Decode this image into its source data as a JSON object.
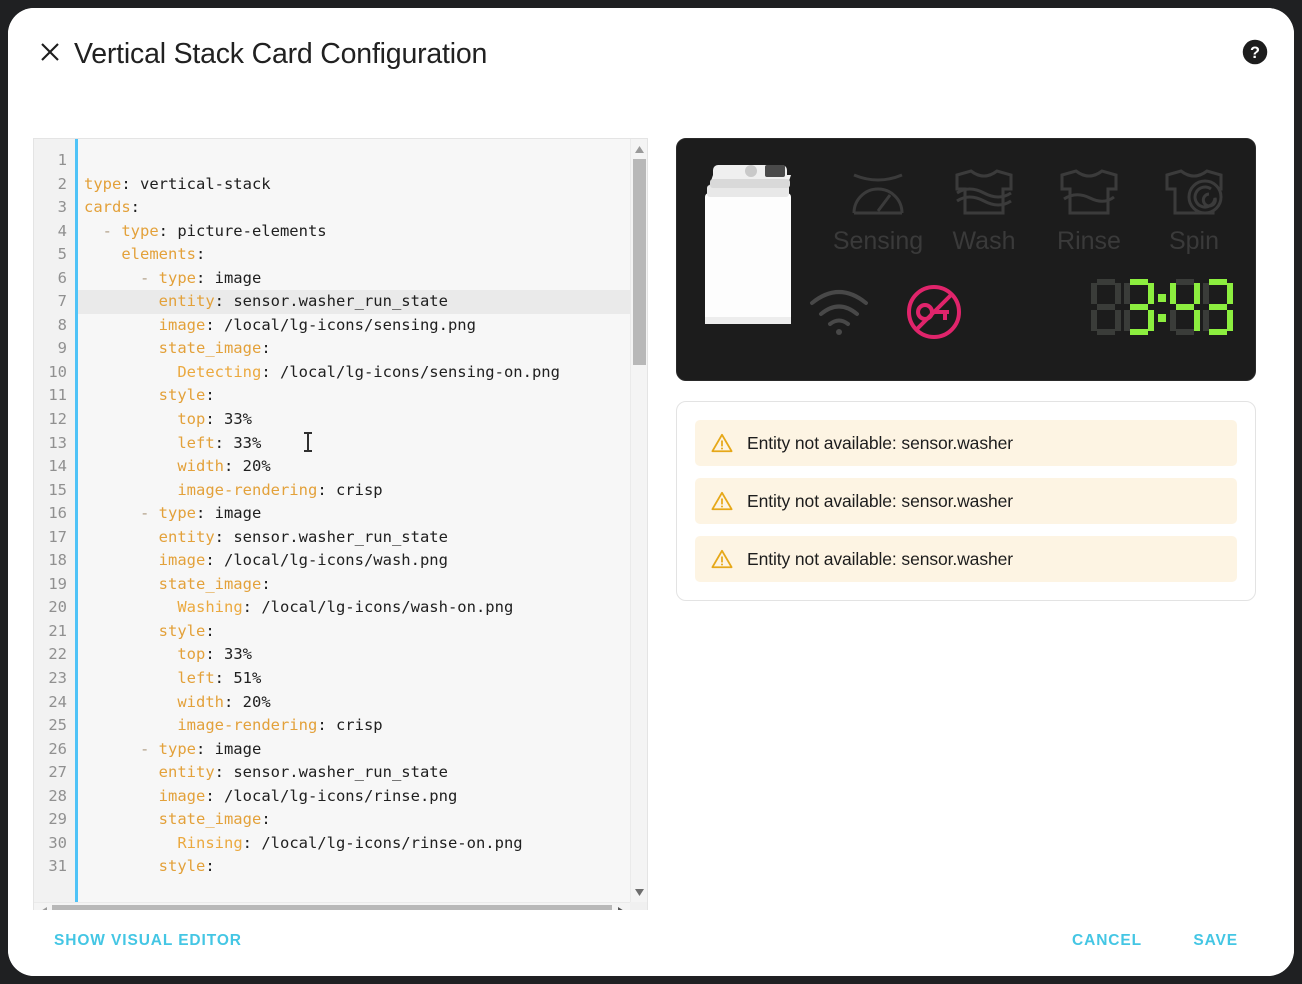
{
  "window": {
    "background_color": "#1f2022",
    "dialog_background": "#ffffff"
  },
  "header": {
    "title": "Vertical Stack Card Configuration",
    "close_icon": "close-icon",
    "help_icon": "help-circle-icon"
  },
  "editor": {
    "language": "yaml",
    "active_line": 7,
    "total_visible_lines": 31,
    "line_numbers": [
      1,
      2,
      3,
      4,
      5,
      6,
      7,
      8,
      9,
      10,
      11,
      12,
      13,
      14,
      15,
      16,
      17,
      18,
      19,
      20,
      21,
      22,
      23,
      24,
      25,
      26,
      27,
      28,
      29,
      30,
      31
    ],
    "lines": [
      {
        "n": 1,
        "segments": []
      },
      {
        "n": 2,
        "segments": [
          {
            "t": "type",
            "c": "key"
          },
          {
            "t": ": vertical-stack",
            "c": "plain"
          }
        ]
      },
      {
        "n": 3,
        "segments": [
          {
            "t": "cards",
            "c": "key"
          },
          {
            "t": ":",
            "c": "plain"
          }
        ]
      },
      {
        "n": 4,
        "segments": [
          {
            "t": "  - ",
            "c": "dash"
          },
          {
            "t": "type",
            "c": "key"
          },
          {
            "t": ": picture-elements",
            "c": "plain"
          }
        ]
      },
      {
        "n": 5,
        "segments": [
          {
            "t": "    ",
            "c": "plain"
          },
          {
            "t": "elements",
            "c": "key"
          },
          {
            "t": ":",
            "c": "plain"
          }
        ]
      },
      {
        "n": 6,
        "segments": [
          {
            "t": "      - ",
            "c": "dash"
          },
          {
            "t": "type",
            "c": "key"
          },
          {
            "t": ": image",
            "c": "plain"
          }
        ]
      },
      {
        "n": 7,
        "segments": [
          {
            "t": "        ",
            "c": "plain"
          },
          {
            "t": "entity",
            "c": "key"
          },
          {
            "t": ": sensor.washer_run_state",
            "c": "plain"
          }
        ]
      },
      {
        "n": 8,
        "segments": [
          {
            "t": "        ",
            "c": "plain"
          },
          {
            "t": "image",
            "c": "key"
          },
          {
            "t": ": /local/lg-icons/sensing.png",
            "c": "plain"
          }
        ]
      },
      {
        "n": 9,
        "segments": [
          {
            "t": "        ",
            "c": "plain"
          },
          {
            "t": "state_image",
            "c": "key"
          },
          {
            "t": ":",
            "c": "plain"
          }
        ]
      },
      {
        "n": 10,
        "segments": [
          {
            "t": "          ",
            "c": "plain"
          },
          {
            "t": "Detecting",
            "c": "key2"
          },
          {
            "t": ": /local/lg-icons/sensing-on.png",
            "c": "plain"
          }
        ]
      },
      {
        "n": 11,
        "segments": [
          {
            "t": "        ",
            "c": "plain"
          },
          {
            "t": "style",
            "c": "key"
          },
          {
            "t": ":",
            "c": "plain"
          }
        ]
      },
      {
        "n": 12,
        "segments": [
          {
            "t": "          ",
            "c": "plain"
          },
          {
            "t": "top",
            "c": "key"
          },
          {
            "t": ": 33%",
            "c": "plain"
          }
        ]
      },
      {
        "n": 13,
        "segments": [
          {
            "t": "          ",
            "c": "plain"
          },
          {
            "t": "left",
            "c": "key"
          },
          {
            "t": ": 33%",
            "c": "plain"
          }
        ]
      },
      {
        "n": 14,
        "segments": [
          {
            "t": "          ",
            "c": "plain"
          },
          {
            "t": "width",
            "c": "key"
          },
          {
            "t": ": 20%",
            "c": "plain"
          }
        ]
      },
      {
        "n": 15,
        "segments": [
          {
            "t": "          ",
            "c": "plain"
          },
          {
            "t": "image-rendering",
            "c": "key"
          },
          {
            "t": ": crisp",
            "c": "plain"
          }
        ]
      },
      {
        "n": 16,
        "segments": [
          {
            "t": "      - ",
            "c": "dash"
          },
          {
            "t": "type",
            "c": "key"
          },
          {
            "t": ": image",
            "c": "plain"
          }
        ]
      },
      {
        "n": 17,
        "segments": [
          {
            "t": "        ",
            "c": "plain"
          },
          {
            "t": "entity",
            "c": "key"
          },
          {
            "t": ": sensor.washer_run_state",
            "c": "plain"
          }
        ]
      },
      {
        "n": 18,
        "segments": [
          {
            "t": "        ",
            "c": "plain"
          },
          {
            "t": "image",
            "c": "key"
          },
          {
            "t": ": /local/lg-icons/wash.png",
            "c": "plain"
          }
        ]
      },
      {
        "n": 19,
        "segments": [
          {
            "t": "        ",
            "c": "plain"
          },
          {
            "t": "state_image",
            "c": "key"
          },
          {
            "t": ":",
            "c": "plain"
          }
        ]
      },
      {
        "n": 20,
        "segments": [
          {
            "t": "          ",
            "c": "plain"
          },
          {
            "t": "Washing",
            "c": "key2"
          },
          {
            "t": ": /local/lg-icons/wash-on.png",
            "c": "plain"
          }
        ]
      },
      {
        "n": 21,
        "segments": [
          {
            "t": "        ",
            "c": "plain"
          },
          {
            "t": "style",
            "c": "key"
          },
          {
            "t": ":",
            "c": "plain"
          }
        ]
      },
      {
        "n": 22,
        "segments": [
          {
            "t": "          ",
            "c": "plain"
          },
          {
            "t": "top",
            "c": "key"
          },
          {
            "t": ": 33%",
            "c": "plain"
          }
        ]
      },
      {
        "n": 23,
        "segments": [
          {
            "t": "          ",
            "c": "plain"
          },
          {
            "t": "left",
            "c": "key"
          },
          {
            "t": ": 51%",
            "c": "plain"
          }
        ]
      },
      {
        "n": 24,
        "segments": [
          {
            "t": "          ",
            "c": "plain"
          },
          {
            "t": "width",
            "c": "key"
          },
          {
            "t": ": 20%",
            "c": "plain"
          }
        ]
      },
      {
        "n": 25,
        "segments": [
          {
            "t": "          ",
            "c": "plain"
          },
          {
            "t": "image-rendering",
            "c": "key"
          },
          {
            "t": ": crisp",
            "c": "plain"
          }
        ]
      },
      {
        "n": 26,
        "segments": [
          {
            "t": "      - ",
            "c": "dash"
          },
          {
            "t": "type",
            "c": "key"
          },
          {
            "t": ": image",
            "c": "plain"
          }
        ]
      },
      {
        "n": 27,
        "segments": [
          {
            "t": "        ",
            "c": "plain"
          },
          {
            "t": "entity",
            "c": "key"
          },
          {
            "t": ": sensor.washer_run_state",
            "c": "plain"
          }
        ]
      },
      {
        "n": 28,
        "segments": [
          {
            "t": "        ",
            "c": "plain"
          },
          {
            "t": "image",
            "c": "key"
          },
          {
            "t": ": /local/lg-icons/rinse.png",
            "c": "plain"
          }
        ]
      },
      {
        "n": 29,
        "segments": [
          {
            "t": "        ",
            "c": "plain"
          },
          {
            "t": "state_image",
            "c": "key"
          },
          {
            "t": ":",
            "c": "plain"
          }
        ]
      },
      {
        "n": 30,
        "segments": [
          {
            "t": "          ",
            "c": "plain"
          },
          {
            "t": "Rinsing",
            "c": "key2"
          },
          {
            "t": ": /local/lg-icons/rinse-on.png",
            "c": "plain"
          }
        ]
      },
      {
        "n": 31,
        "segments": [
          {
            "t": "        ",
            "c": "plain"
          },
          {
            "t": "style",
            "c": "key"
          },
          {
            "t": ":",
            "c": "plain"
          }
        ]
      }
    ],
    "colors": {
      "key": "#e3a13a",
      "nested_key": "#eba93f",
      "plain": "#202020",
      "active_line_background": "#eaeaea",
      "gutter_accent": "#4fc3f7",
      "background": "#f7f7f7"
    }
  },
  "preview": {
    "washer_card": {
      "background_color": "#1c1c1c",
      "appliance_icon": "washing-machine-icon",
      "cycles": [
        {
          "label": "Sensing",
          "icon": "sensing-gauge-icon",
          "active": false
        },
        {
          "label": "Wash",
          "icon": "wash-shirt-icon",
          "active": false
        },
        {
          "label": "Rinse",
          "icon": "rinse-shirt-icon",
          "active": false
        },
        {
          "label": "Spin",
          "icon": "spin-shirt-icon",
          "active": false
        }
      ],
      "status_icons": [
        {
          "name": "wifi-icon",
          "color": "#4a4a4a",
          "active": false
        },
        {
          "name": "child-lock-off-icon",
          "color": "#e0246b",
          "active": true
        }
      ],
      "display": {
        "value": "3:43",
        "segment_on_color": "#8cee3f",
        "segment_off_color": "#3a3c39",
        "digits": [
          {
            "char": "1",
            "lit": false
          },
          {
            "char": "3",
            "lit": true
          },
          {
            "char": "4",
            "lit": true
          },
          {
            "char": "3",
            "lit": true
          }
        ]
      }
    },
    "warnings_card": {
      "warnings": [
        {
          "icon": "warning-triangle-icon",
          "text": "Entity not available: sensor.washer"
        },
        {
          "icon": "warning-triangle-icon",
          "text": "Entity not available: sensor.washer"
        },
        {
          "icon": "warning-triangle-icon",
          "text": "Entity not available: sensor.washer"
        }
      ],
      "background_color": "#fdf4e3",
      "icon_color": "#e6a819"
    }
  },
  "footer": {
    "visual_editor_label": "SHOW VISUAL EDITOR",
    "cancel_label": "CANCEL",
    "save_label": "SAVE",
    "accent_color": "#44c6e4"
  }
}
